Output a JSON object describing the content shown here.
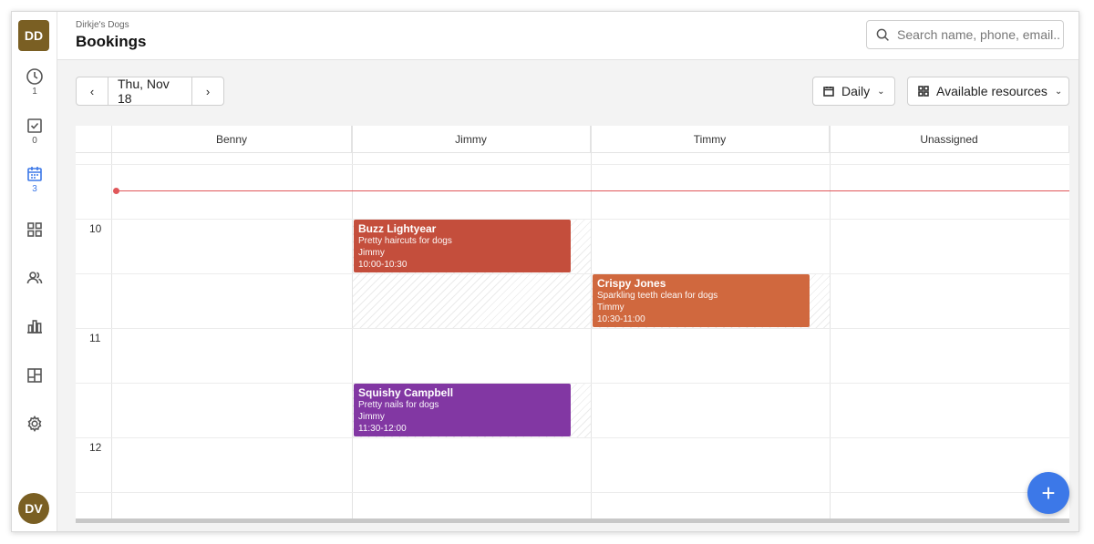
{
  "org": {
    "name": "Dirkje's Dogs",
    "initials": "DD"
  },
  "user": {
    "initials": "DV"
  },
  "page": {
    "title": "Bookings"
  },
  "search": {
    "placeholder": "Search name, phone, email.."
  },
  "sidebar": {
    "items": [
      {
        "icon": "clock-icon",
        "count": "1",
        "active": false
      },
      {
        "icon": "checkbox-icon",
        "count": "0",
        "active": false
      },
      {
        "icon": "calendar-icon",
        "count": "3",
        "active": true
      },
      {
        "icon": "grid-icon",
        "count": "",
        "active": false
      },
      {
        "icon": "users-icon",
        "count": "",
        "active": false
      },
      {
        "icon": "bar-chart-icon",
        "count": "",
        "active": false
      },
      {
        "icon": "layout-icon",
        "count": "",
        "active": false
      },
      {
        "icon": "gear-icon",
        "count": "",
        "active": false
      }
    ]
  },
  "toolbar": {
    "prev": "‹",
    "date": "Thu, Nov 18",
    "next": "›",
    "view": "Daily",
    "resources": "Available resources"
  },
  "calendar": {
    "resources": [
      "Benny",
      "Jimmy",
      "Timmy",
      "Unassigned"
    ],
    "hours": [
      "10",
      "11",
      "12"
    ],
    "events": [
      {
        "title": "Buzz Lightyear",
        "service": "Pretty haircuts for dogs",
        "staff": "Jimmy",
        "time": "10:00-10:30",
        "color": "#c44e3c"
      },
      {
        "title": "Crispy Jones",
        "service": "Sparkling teeth clean for dogs",
        "staff": "Timmy",
        "time": "10:30-11:00",
        "color": "#d0683e"
      },
      {
        "title": "Squishy Campbell",
        "service": "Pretty nails for dogs",
        "staff": "Jimmy",
        "time": "11:30-12:00",
        "color": "#8237a3"
      }
    ]
  },
  "fab": {
    "label": "+"
  },
  "colors": {
    "accent": "#3c78e8",
    "now_line": "#e0575a"
  }
}
